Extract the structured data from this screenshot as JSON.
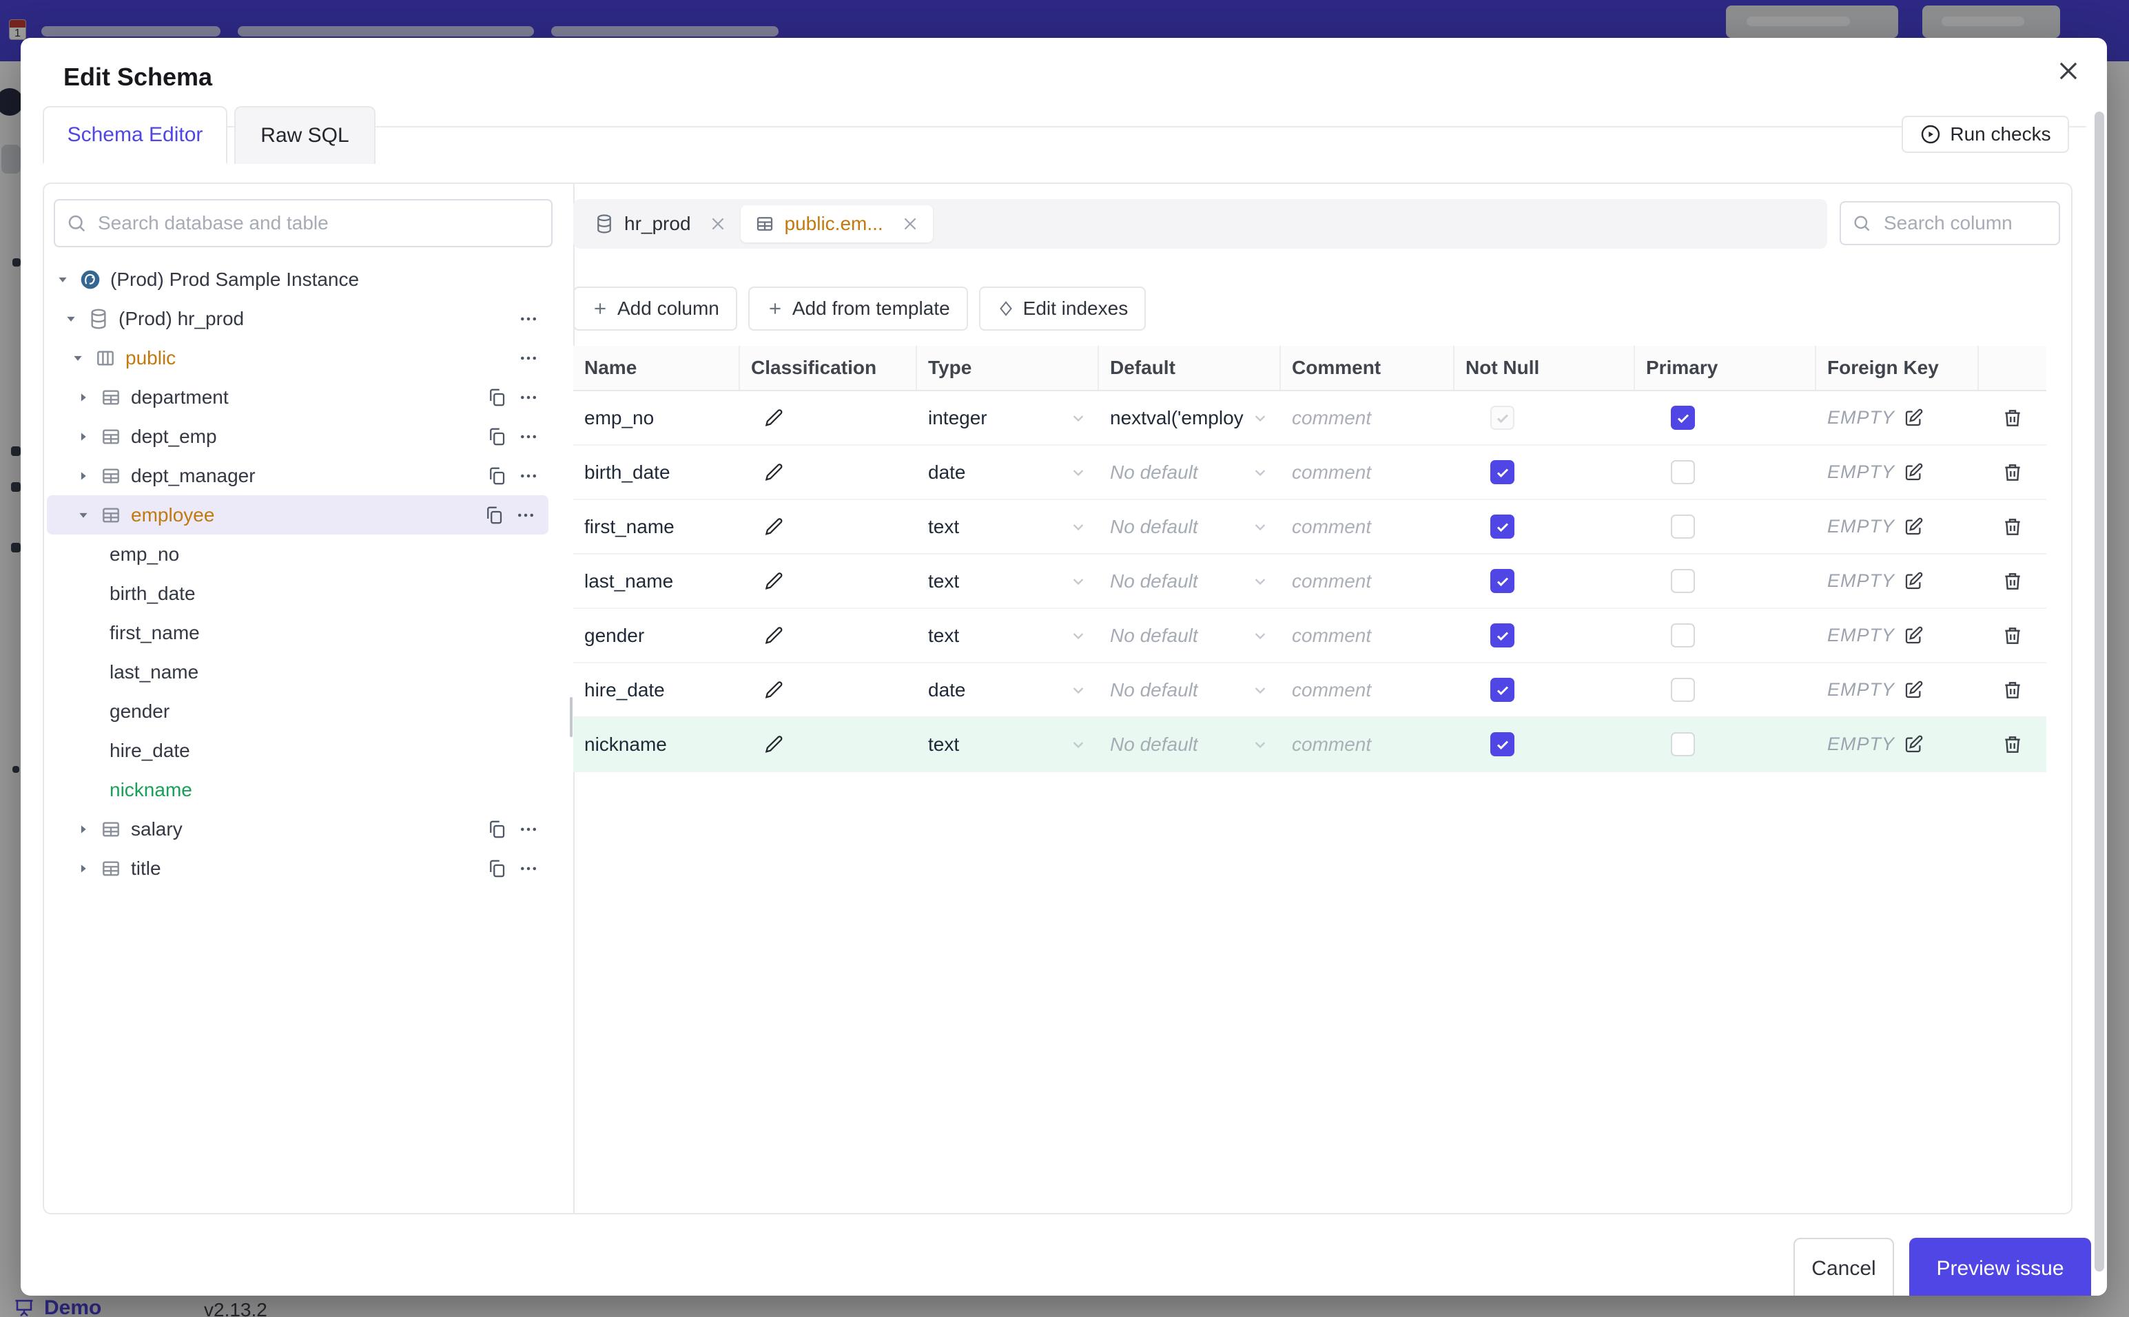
{
  "modal": {
    "title": "Edit Schema",
    "tabs": {
      "schema_editor": "Schema Editor",
      "raw_sql": "Raw SQL"
    },
    "run_checks_label": "Run checks"
  },
  "sidebar": {
    "search_placeholder": "Search database and table",
    "tree": [
      {
        "label": "(Prod) Prod Sample Instance",
        "icon": "postgres",
        "expanded": true
      },
      {
        "label": "(Prod) hr_prod",
        "icon": "database",
        "expanded": true
      },
      {
        "label": "public",
        "icon": "schema",
        "expanded": true,
        "changed": true
      },
      {
        "label": "department",
        "icon": "table",
        "expanded": false
      },
      {
        "label": "dept_emp",
        "icon": "table",
        "expanded": false
      },
      {
        "label": "dept_manager",
        "icon": "table",
        "expanded": false
      },
      {
        "label": "employee",
        "icon": "table",
        "expanded": true,
        "changed": true,
        "selected": true
      },
      {
        "label": "emp_no",
        "icon": "none"
      },
      {
        "label": "birth_date",
        "icon": "none"
      },
      {
        "label": "first_name",
        "icon": "none"
      },
      {
        "label": "last_name",
        "icon": "none"
      },
      {
        "label": "gender",
        "icon": "none"
      },
      {
        "label": "hire_date",
        "icon": "none"
      },
      {
        "label": "nickname",
        "icon": "none",
        "added": true
      },
      {
        "label": "salary",
        "icon": "table",
        "expanded": false
      },
      {
        "label": "title",
        "icon": "table",
        "expanded": false
      }
    ]
  },
  "editor": {
    "chips": [
      {
        "label": "hr_prod",
        "icon": "database",
        "active": false
      },
      {
        "label": "public.em...",
        "icon": "table",
        "active": true
      }
    ],
    "search_placeholder": "Search column",
    "toolbar": {
      "add_column": "Add column",
      "add_from_template": "Add from template",
      "edit_indexes": "Edit indexes"
    },
    "table": {
      "headers": [
        "Name",
        "Classification",
        "Type",
        "Default",
        "Comment",
        "Not Null",
        "Primary",
        "Foreign Key"
      ],
      "comment_placeholder": "comment",
      "fk_empty": "EMPTY",
      "rows": [
        {
          "name": "emp_no",
          "type": "integer",
          "default_text": "nextval('employ",
          "default_is_placeholder": false,
          "not_null_checked": true,
          "not_null_disabled": true,
          "primary_checked": true,
          "foreign_key": "EMPTY",
          "highlighted": false
        },
        {
          "name": "birth_date",
          "type": "date",
          "default_text": "No default",
          "default_is_placeholder": true,
          "not_null_checked": true,
          "not_null_disabled": false,
          "primary_checked": false,
          "foreign_key": "EMPTY",
          "highlighted": false
        },
        {
          "name": "first_name",
          "type": "text",
          "default_text": "No default",
          "default_is_placeholder": true,
          "not_null_checked": true,
          "not_null_disabled": false,
          "primary_checked": false,
          "foreign_key": "EMPTY",
          "highlighted": false
        },
        {
          "name": "last_name",
          "type": "text",
          "default_text": "No default",
          "default_is_placeholder": true,
          "not_null_checked": true,
          "not_null_disabled": false,
          "primary_checked": false,
          "foreign_key": "EMPTY",
          "highlighted": false
        },
        {
          "name": "gender",
          "type": "text",
          "default_text": "No default",
          "default_is_placeholder": true,
          "not_null_checked": true,
          "not_null_disabled": false,
          "primary_checked": false,
          "foreign_key": "EMPTY",
          "highlighted": false
        },
        {
          "name": "hire_date",
          "type": "date",
          "default_text": "No default",
          "default_is_placeholder": true,
          "not_null_checked": true,
          "not_null_disabled": false,
          "primary_checked": false,
          "foreign_key": "EMPTY",
          "highlighted": false
        },
        {
          "name": "nickname",
          "type": "text",
          "default_text": "No default",
          "default_is_placeholder": true,
          "not_null_checked": true,
          "not_null_disabled": false,
          "primary_checked": false,
          "foreign_key": "EMPTY",
          "highlighted": true
        }
      ]
    }
  },
  "footer": {
    "cancel": "Cancel",
    "preview_issue": "Preview issue"
  },
  "background": {
    "demo_label": "Demo",
    "version": "v2.13.2",
    "calendar_day": "1"
  },
  "colors": {
    "accent_indigo": "#4F46E5",
    "changed_amber": "#C2790D",
    "added_green": "#18A058",
    "selected_row_bg": "#ECEAF9",
    "added_row_bg": "#E9F8F0",
    "topbar_indigo": "#4A43D6"
  }
}
